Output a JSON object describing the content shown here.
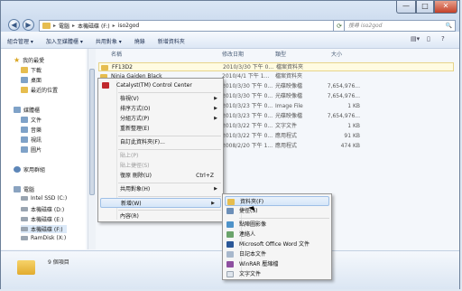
{
  "window": {
    "caption_buttons": {
      "minimize": "—",
      "maximize": "□",
      "close": "✕"
    },
    "address_parts": [
      "電腦",
      "本機磁碟 (F:)",
      "iso2god"
    ],
    "address_sep": "▸",
    "search_placeholder": "搜尋 iso2god",
    "search_icon": "🔍"
  },
  "toolbar": {
    "items": [
      "組合管理 ▾",
      "加入至媒體櫃 ▾",
      "共用對象 ▾",
      "燒錄",
      "新增資料夾"
    ]
  },
  "sidebar": {
    "favorites": {
      "title": "我的最愛",
      "items": [
        "下載",
        "桌面",
        "最近的位置"
      ]
    },
    "libraries": {
      "title": "媒體櫃",
      "items": [
        "文件",
        "音樂",
        "視訊",
        "圖片"
      ]
    },
    "homegroup": "家用群組",
    "computer": {
      "title": "電腦",
      "items": [
        "Intel SSD (C:)",
        "本機磁碟 (D:)",
        "本機磁碟 (E:)",
        "本機磁碟 (F:)",
        "RamDisk (X:)"
      ]
    }
  },
  "columns": {
    "name": "名稱",
    "date": "修改日期",
    "type": "類型",
    "size": "大小"
  },
  "files": [
    {
      "name": "FF13D2",
      "date": "2010/3/30 下午 0...",
      "type": "檔案資料夾",
      "size": ""
    },
    {
      "name": "Ninja Gaiden Black",
      "date": "2010/4/1 下午 1...",
      "type": "檔案資料夾",
      "size": ""
    },
    {
      "name": "",
      "date": "2010/3/30 下午 0...",
      "type": "光碟映像檔",
      "size": "7,654,976..."
    },
    {
      "name": "",
      "date": "2010/3/30 下午 0...",
      "type": "光碟映像檔",
      "size": "7,654,976..."
    },
    {
      "name": "",
      "date": "2010/3/23 下午 0...",
      "type": "Image File",
      "size": "1 KB"
    },
    {
      "name": "",
      "date": "2010/3/23 下午 0...",
      "type": "光碟映像檔",
      "size": "7,654,976..."
    },
    {
      "name": "",
      "date": "2010/3/22 下午 0...",
      "type": "文字文件",
      "size": "1 KB"
    },
    {
      "name": "",
      "date": "2010/3/22 下午 0...",
      "type": "應用程式",
      "size": "91 KB"
    },
    {
      "name": "",
      "date": "2008/2/20 下午 1...",
      "type": "應用程式",
      "size": "474 KB"
    }
  ],
  "status": {
    "count": "9 個項目"
  },
  "context_menu": {
    "catalyst": "Catalyst(TM) Control Center",
    "view": "檢視(V)",
    "sort": "排序方式(O)",
    "group": "分組方式(P)",
    "refresh": "重新整理(E)",
    "customize": "自訂此資料夾(F)...",
    "paste": "貼上(P)",
    "paste_shortcut": "貼上捷徑(S)",
    "undo": "復原 刪除(U)",
    "undo_shortcut": "Ctrl+Z",
    "share": "共用對象(H)",
    "new": "新增(W)",
    "properties": "內容(R)"
  },
  "submenu": {
    "folder": "資料夾(F)",
    "shortcut": "捷徑(S)",
    "bitmap": "點陣圖影像",
    "contact": "連絡人",
    "word": "Microsoft Office Word 文件",
    "journal": "日記本文件",
    "winrar": "WinRAR 壓縮檔",
    "text": "文字文件"
  }
}
